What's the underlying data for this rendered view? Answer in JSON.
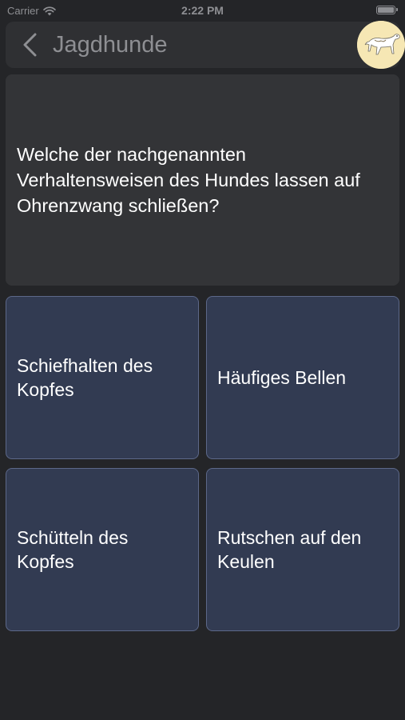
{
  "status_bar": {
    "carrier": "Carrier",
    "time": "2:22 PM",
    "wifi_icon": "wifi-icon",
    "battery_icon": "battery-icon"
  },
  "nav": {
    "back_icon": "chevron-left-icon",
    "title": "Jagdhunde",
    "avatar_icon": "dog-logo"
  },
  "question": {
    "text": "Welche der nachgenannten Verhaltensweisen des Hundes lassen auf Ohrenzwang schließen?"
  },
  "answers": [
    {
      "label": "Schiefhalten des Kopfes"
    },
    {
      "label": "Häufiges Bellen"
    },
    {
      "label": "Schütteln des Kopfes"
    },
    {
      "label": "Rutschen auf den Keulen"
    }
  ],
  "colors": {
    "background": "#242528",
    "nav_background": "#2f3033",
    "card_background": "#333437",
    "answer_background": "#323b52",
    "answer_border": "#5c6889",
    "muted_text": "#8e8f93",
    "avatar_background": "#f6e7b4"
  }
}
